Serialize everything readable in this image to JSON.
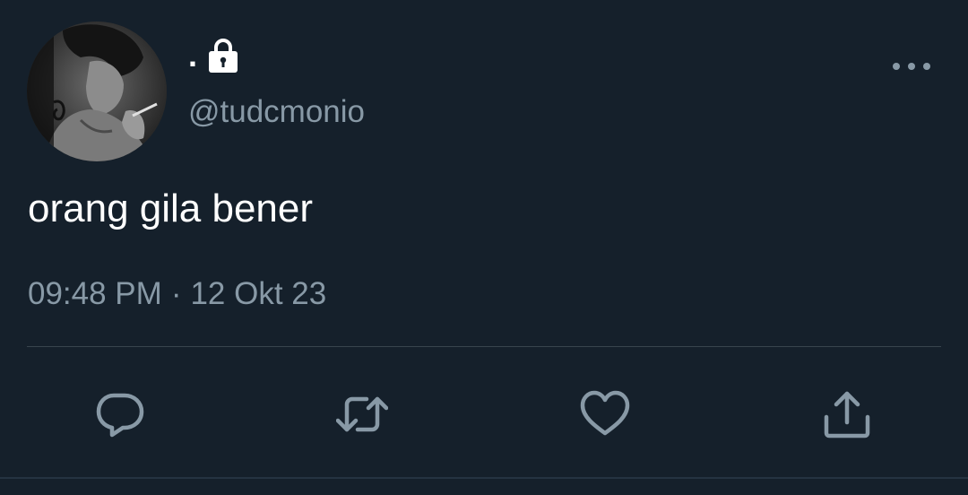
{
  "tweet": {
    "display_name": ".",
    "handle": "@tudcmonio",
    "text": "orang gila bener",
    "time": "09:48 PM",
    "separator": "·",
    "date": "12 Okt 23",
    "protected": true
  },
  "icons": {
    "lock": "lock-icon",
    "more": "more-icon",
    "reply": "reply-icon",
    "retweet": "retweet-icon",
    "like": "heart-icon",
    "share": "share-icon"
  },
  "colors": {
    "background": "#15202b",
    "primary_text": "#ffffff",
    "secondary_text": "#8899a6",
    "divider": "#38444d"
  }
}
